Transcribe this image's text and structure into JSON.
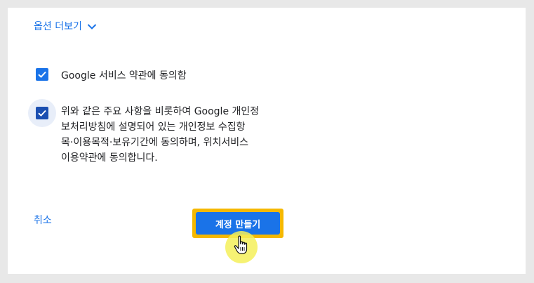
{
  "more_options": {
    "label": "옵션 더보기",
    "icon": "chevron-down-icon"
  },
  "terms": {
    "google_terms": {
      "checked": true,
      "label": "Google 서비스 약관에 동의함"
    },
    "privacy_consent": {
      "checked": true,
      "lines": [
        "위와 같은 주요 사항을 비롯하여 Google 개인정",
        "보처리방침에 설명되어 있는 개인정보 수집항",
        "목·이용목적·보유기간에 동의하며, 위치서비스",
        "이용약관에 동의합니다."
      ]
    }
  },
  "actions": {
    "cancel_label": "취소",
    "create_label": "계정 만들기"
  },
  "colors": {
    "accent": "#1a73e8",
    "highlight": "#f5b800",
    "cursor_glow": "#f4f05a"
  },
  "cursor": {
    "icon": "hand-pointer-icon"
  }
}
